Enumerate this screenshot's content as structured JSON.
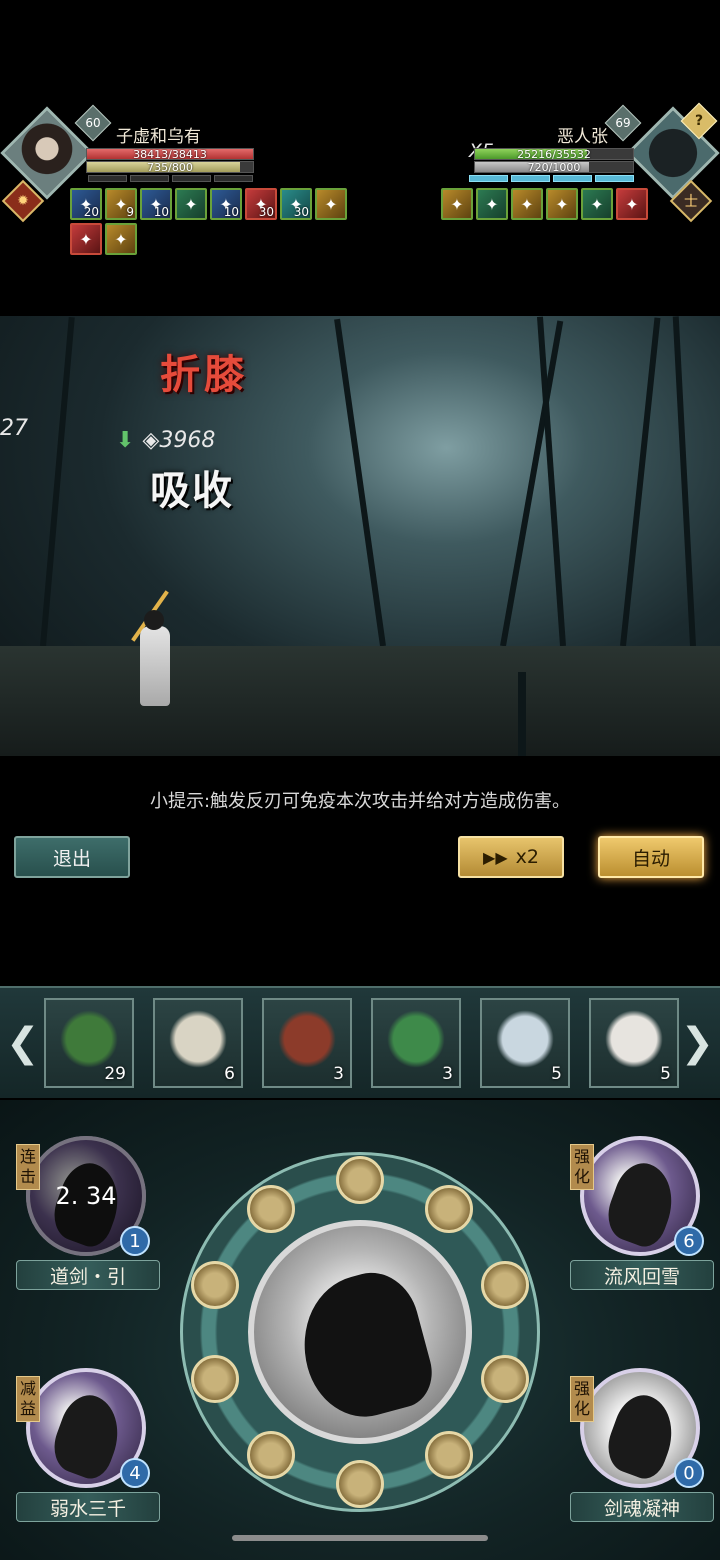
{
  "player": {
    "name": "子虚和乌有",
    "level": "60",
    "hp_text": "38413/38413",
    "hp_fraction": 1.0,
    "mp_text": "735/800",
    "mp_fraction": 0.92,
    "buffs": [
      {
        "icon": "sword-dash-icon",
        "count": "20",
        "color": "blue"
      },
      {
        "icon": "fist-icon",
        "count": "9",
        "color": "gold"
      },
      {
        "icon": "sword-dash-icon",
        "count": "10",
        "color": "blue"
      },
      {
        "icon": "lotus-icon",
        "count": "",
        "color": "green"
      },
      {
        "icon": "sword-dash-icon",
        "count": "10",
        "color": "blue"
      },
      {
        "icon": "strike-icon",
        "count": "30",
        "color": "red"
      },
      {
        "icon": "arrow-up-icon",
        "count": "30",
        "color": "teal"
      },
      {
        "icon": "figure-icon",
        "count": "",
        "color": "gold"
      },
      {
        "icon": "kneel-icon",
        "count": "",
        "color": "red"
      },
      {
        "icon": "slash-icon",
        "count": "",
        "color": "gold"
      }
    ]
  },
  "enemy": {
    "name": "恶人张",
    "level": "69",
    "multiplier": "X5",
    "hp_text": "25216/35532",
    "hp_fraction": 0.71,
    "mp_text": "720/1000",
    "mp_fraction": 0.72,
    "unknown_badge": "?",
    "buffs": [
      {
        "icon": "sword-dash-icon",
        "count": "",
        "color": "gold"
      },
      {
        "icon": "lotus-icon",
        "count": "",
        "color": "green"
      },
      {
        "icon": "slash-icon",
        "count": "",
        "color": "gold"
      },
      {
        "icon": "strike-icon",
        "count": "",
        "color": "gold"
      },
      {
        "icon": "lotus-plus-icon",
        "count": "",
        "color": "green"
      },
      {
        "icon": "shield-icon",
        "count": "",
        "color": "red"
      }
    ]
  },
  "battle": {
    "skill_name": "折膝",
    "absorb_value": "3968",
    "absorb_label": "吸收",
    "side_number": "27"
  },
  "hint": "小提示:触发反刃可免疫本次攻击并给对方造成伤害。",
  "controls": {
    "exit": "退出",
    "speed": "x2",
    "auto": "自动"
  },
  "items": [
    {
      "icon": "herb-bundle-icon",
      "qty": "29",
      "color": "#3f7a3a"
    },
    {
      "icon": "jade-seal-icon",
      "qty": "6",
      "color": "#d9d4c4"
    },
    {
      "icon": "medicine-bowl-icon",
      "qty": "3",
      "color": "#8c3b2a"
    },
    {
      "icon": "peacock-feather-icon",
      "qty": "3",
      "color": "#3e8a4a"
    },
    {
      "icon": "potion-bottle-icon",
      "qty": "5",
      "color": "#c9d7e0"
    },
    {
      "icon": "gourd-icon",
      "qty": "5",
      "color": "#e7e4df"
    }
  ],
  "skills": [
    {
      "name": "道剑・引",
      "tag": "连击",
      "count": "1",
      "cooldown": "2. 34",
      "style": "purple"
    },
    {
      "name": "流风回雪",
      "tag": "强化",
      "count": "6",
      "cooldown": "",
      "style": "purple"
    },
    {
      "name": "弱水三千",
      "tag": "减益",
      "count": "4",
      "cooldown": "",
      "style": "purple"
    },
    {
      "name": "剑魂凝神",
      "tag": "强化",
      "count": "0",
      "cooldown": "",
      "style": "white"
    }
  ]
}
